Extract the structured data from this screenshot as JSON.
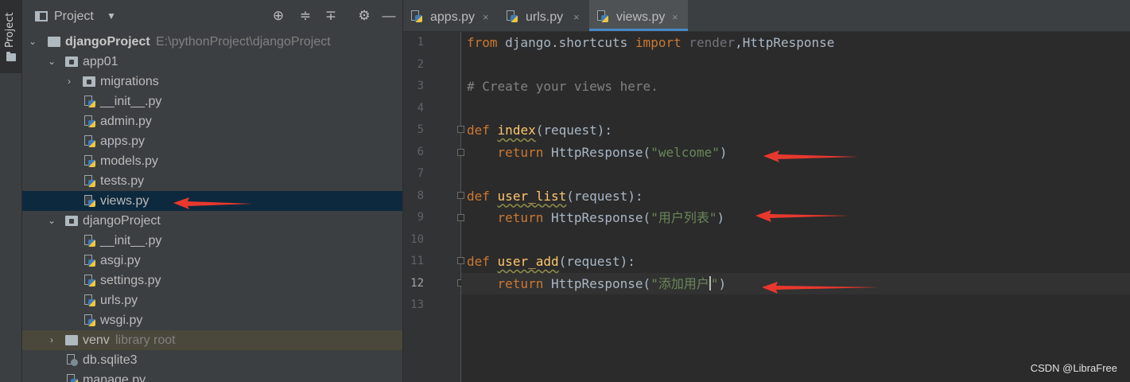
{
  "sidebar_stripe": {
    "label": "Project"
  },
  "project_panel": {
    "title": "Project",
    "tree": [
      {
        "label": "djangoProject",
        "hint": "E:\\pythonProject\\djangoProject",
        "kind": "root",
        "state": "expanded"
      },
      {
        "label": "app01",
        "kind": "folder",
        "state": "expanded"
      },
      {
        "label": "migrations",
        "kind": "folder",
        "state": "collapsed"
      },
      {
        "label": "__init__.py",
        "kind": "python"
      },
      {
        "label": "admin.py",
        "kind": "python"
      },
      {
        "label": "apps.py",
        "kind": "python"
      },
      {
        "label": "models.py",
        "kind": "python"
      },
      {
        "label": "tests.py",
        "kind": "python"
      },
      {
        "label": "views.py",
        "kind": "python",
        "selected": true
      },
      {
        "label": "djangoProject",
        "kind": "folder",
        "state": "expanded"
      },
      {
        "label": "__init__.py",
        "kind": "python"
      },
      {
        "label": "asgi.py",
        "kind": "python"
      },
      {
        "label": "settings.py",
        "kind": "python"
      },
      {
        "label": "urls.py",
        "kind": "python"
      },
      {
        "label": "wsgi.py",
        "kind": "python"
      },
      {
        "label": "venv",
        "hint": "library root",
        "kind": "folder",
        "state": "collapsed"
      },
      {
        "label": "db.sqlite3",
        "kind": "database"
      },
      {
        "label": "manage.py",
        "kind": "python"
      }
    ]
  },
  "editor": {
    "tabs": [
      {
        "label": "apps.py",
        "close": "×",
        "active": false
      },
      {
        "label": "urls.py",
        "close": "×",
        "active": false
      },
      {
        "label": "views.py",
        "close": "×",
        "active": true
      }
    ],
    "line_numbers": [
      "1",
      "2",
      "3",
      "4",
      "5",
      "6",
      "7",
      "8",
      "9",
      "10",
      "11",
      "12",
      "13"
    ],
    "current_line": "12",
    "code": {
      "l1": {
        "kw1": "from",
        "mod": " django.shortcuts ",
        "kw2": "import",
        "dim": " render",
        "rest": ",HttpResponse"
      },
      "l3": {
        "comment": "# Create your views here."
      },
      "l5": {
        "kw": "def",
        "name": "index",
        "args": "(request):"
      },
      "l6": {
        "kw": "return",
        "call": " HttpResponse(",
        "str": "\"welcome\"",
        "end": ")"
      },
      "l8": {
        "kw": "def",
        "name": "user_list",
        "args": "(request):"
      },
      "l9": {
        "kw": "return",
        "call": " HttpResponse(",
        "str": "\"用户列表\"",
        "end": ")"
      },
      "l11": {
        "kw": "def",
        "name": "user_add",
        "args": "(request):"
      },
      "l12": {
        "kw": "return",
        "call": " HttpResponse(",
        "str_a": "\"添加用户",
        "str_b": "\"",
        "end": ")"
      }
    }
  },
  "watermark": "CSDN @LibraFree",
  "colors": {
    "keyword": "#cc7832",
    "function": "#ffc66d",
    "string": "#6a8759",
    "comment": "#808080",
    "arrow": "#e8382e",
    "selection": "#0d293e"
  }
}
